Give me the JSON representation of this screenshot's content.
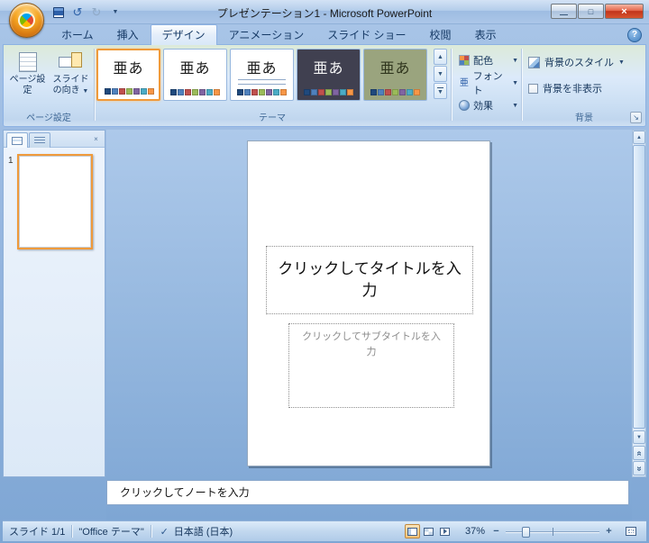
{
  "window": {
    "title": "プレゼンテーション1 - Microsoft PowerPoint"
  },
  "titlebar_icons": {
    "undo": "↺",
    "redo": "↻",
    "qat_menu": "▼",
    "minimize": "—",
    "maximize": "□",
    "close": "×",
    "help": "?"
  },
  "ribbon": {
    "tabs": [
      {
        "label": "ホーム"
      },
      {
        "label": "挿入"
      },
      {
        "label": "デザイン"
      },
      {
        "label": "アニメーション"
      },
      {
        "label": "スライド ショー"
      },
      {
        "label": "校閲"
      },
      {
        "label": "表示"
      }
    ],
    "active_tab": "デザイン",
    "page_setup_group": {
      "label": "ページ設定",
      "page_setup_button": "ページ設定",
      "orientation_button": "スライドの向き"
    },
    "themes_group": {
      "label": "テーマ",
      "sample_text": "亜あ",
      "palette": [
        "#1f497d",
        "#4f81bd",
        "#c0504d",
        "#9bbb59",
        "#8064a2",
        "#4bacc6",
        "#f79646"
      ],
      "items": [
        {
          "bg": "#ffffff",
          "fg": "#1a1a1a",
          "selected": true
        },
        {
          "bg": "#ffffff",
          "fg": "#1a1a1a",
          "selected": false
        },
        {
          "bg": "#ffffff",
          "fg": "#1a1a1a",
          "selected": false
        },
        {
          "bg": "#404050",
          "fg": "#f5f5f5",
          "selected": false
        },
        {
          "bg": "#9aa47e",
          "fg": "#2f351d",
          "selected": false
        }
      ],
      "scroll": {
        "up": "▲",
        "down": "▼",
        "more": "▼"
      }
    },
    "theme_tools": {
      "colors": "配色",
      "fonts": "フォント",
      "effects": "効果",
      "fonts_icon_glyph": "亜",
      "dropdown": "▼"
    },
    "background_group": {
      "label": "背景",
      "styles_button": "背景のスタイル",
      "hide_background_checkbox": "背景を非表示",
      "launcher": "↘"
    }
  },
  "slides_pane": {
    "slide_number": "1",
    "close": "×"
  },
  "editor": {
    "title_placeholder": "クリックしてタイトルを入力",
    "subtitle_placeholder": "クリックしてサブタイトルを入力"
  },
  "notes": {
    "placeholder": "クリックしてノートを入力"
  },
  "scrollbar": {
    "up": "▲",
    "down": "▼",
    "prev": "«",
    "next": "»"
  },
  "status_bar": {
    "slide_indicator": "スライド 1/1",
    "theme_name": "\"Office テーマ\"",
    "proofing_check": "✓",
    "language": "日本語 (日本)",
    "zoom_percent": "37%",
    "zoom_out": "−",
    "zoom_in": "+"
  }
}
